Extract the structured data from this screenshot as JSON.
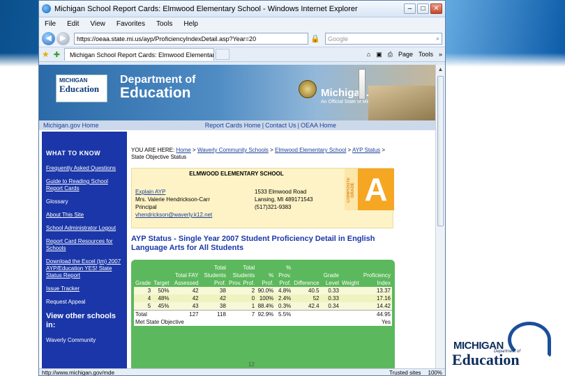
{
  "browser": {
    "title": "Michigan School Report Cards: Elmwood Elementary School - Windows Internet Explorer",
    "menu": [
      "File",
      "Edit",
      "View",
      "Favorites",
      "Tools",
      "Help"
    ],
    "url": "https://oeaa.state.mi.us/ayp/ProficiencyIndexDetail.asp?Year=20",
    "search_placeholder": "Google",
    "tab_label": "Michigan School Report Cards: Elmwood Elementary S...",
    "tools": [
      "Page",
      "Tools"
    ],
    "status_url": "http://www.michigan.gov/mde",
    "status_zone": "Trusted sites",
    "status_zoom": "100%"
  },
  "site": {
    "logo_line1": "MICHIGAN",
    "logo_line2": "Education",
    "dept_line1": "Department of",
    "dept_line2": "Education",
    "migov": "Michigan.gov",
    "migov_sub": "An Official State of Michigan Web Site",
    "nav_home": "Michigan.gov Home",
    "nav_links": [
      "Report Cards Home",
      "Contact Us",
      "OEAA Home"
    ]
  },
  "sidebar": {
    "heading": "WHAT TO KNOW",
    "links": [
      "Frequently Asked Questions",
      "Guide to Reading School Report Cards",
      "Glossary",
      "About This Site",
      "School Administrator Logout",
      "Report Card Resources for Schools",
      "Download the Excel (tm) 2007 AYP/Education YES! State Status Report",
      "Issue Tracker",
      "Request Appeal"
    ],
    "view_other": "View other schools in:",
    "bottom_link": "Waverly Community"
  },
  "content": {
    "crumb_prefix": "YOU ARE HERE:",
    "crumbs": [
      "Home",
      "Waverly Community Schools",
      "Elmwood Elementary School",
      "AYP Status"
    ],
    "crumb_last": "State Objective Status",
    "school_name": "ELMWOOD ELEMENTARY SCHOOL",
    "explain": "Explain AYP",
    "principal_name": "Mrs. Valerie Hendrickson-Carr",
    "principal_title": "Principal",
    "email": "vhendrickson@waverly.k12.net",
    "address1": "1533 Elmwood Road",
    "address2": "Lansing, MI 489171543",
    "phone": "(517)321-9383",
    "composite_label": "COMPOSITE GRADE",
    "grade_letter": "A",
    "ayp_title": "AYP Status - Single Year 2007 Student Proficiency Detail in English Language Arts for All Students"
  },
  "table": {
    "headers": [
      "Grade",
      "Target",
      "Total FAY Assessed",
      "Total Students Prof.",
      "Total Students Prov. Prof.",
      "% Prof.",
      "% Prov. Prof.",
      "Difference",
      "Grade Level",
      "Weight",
      "Proficiency Index"
    ],
    "rows": [
      [
        "3",
        "50%",
        "42",
        "38",
        "2",
        "90.0%",
        "4.8%",
        "40.5",
        "0.33",
        "",
        "13.37"
      ],
      [
        "4",
        "48%",
        "42",
        "42",
        "0",
        "100%",
        "2.4%",
        "52",
        "0.33",
        "",
        "17.16"
      ],
      [
        "5",
        "45%",
        "43",
        "38",
        "1",
        "88.4%",
        "0.3%",
        "42.4",
        "0.34",
        "",
        "14.42"
      ]
    ],
    "total_label": "Total",
    "total_values": [
      "127",
      "118",
      "7",
      "92.9%",
      "5.5%",
      "",
      "",
      "",
      "44.95"
    ],
    "met_label": "Met State Objective",
    "met_value": "Yes"
  },
  "page_number": "12",
  "slide_logo": {
    "line1": "MICHIGAN",
    "dept": "Department of",
    "line2": "Education"
  },
  "colors": {
    "sidebar": "#1a36a8",
    "grade_orange": "#f5a623",
    "table_green": "#5cb85c",
    "school_box": "#fdf3c6"
  }
}
